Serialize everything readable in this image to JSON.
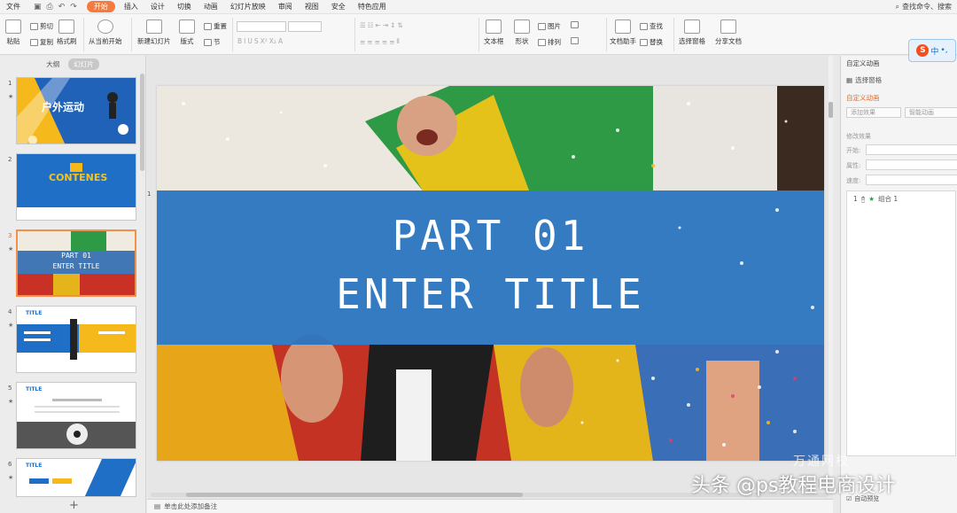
{
  "menu": {
    "file_label": "文件",
    "tabs": [
      "开始",
      "插入",
      "设计",
      "切换",
      "动画",
      "幻灯片放映",
      "审阅",
      "视图",
      "安全",
      "特色应用"
    ],
    "active_tab": "开始",
    "search_label": "查找命令、搜索"
  },
  "ribbon": {
    "paste": "粘贴",
    "cut": "剪切",
    "copy": "复制",
    "format_painter": "格式刷",
    "play_from_current": "从当前开始",
    "new_slide": "新建幻灯片",
    "layout": "版式",
    "reset": "重置",
    "section": "节",
    "textbox": "文本框",
    "shape": "形状",
    "picture": "图片",
    "arrange": "排列",
    "doc_assistant": "文档助手",
    "find": "查找",
    "replace": "替换",
    "select_pane": "选择窗格",
    "share_doc": "分享文档"
  },
  "left_panel": {
    "tab_outline": "大纲",
    "tab_slides": "幻灯片",
    "slides": [
      {
        "num": "1",
        "title": "户外运动"
      },
      {
        "num": "2",
        "title": "CONTENES"
      },
      {
        "num": "3",
        "title_line1": "PART 01",
        "title_line2": "ENTER TITLE"
      },
      {
        "num": "4",
        "title": "TITLE"
      },
      {
        "num": "5",
        "title": "TITLE"
      },
      {
        "num": "6",
        "title": "TITLE"
      }
    ],
    "add_icon": "+"
  },
  "slide": {
    "marker": "1",
    "title_line1": "PART 01",
    "title_line2": "ENTER TITLE"
  },
  "notes": {
    "placeholder": "单击此处添加备注"
  },
  "right_panel": {
    "title": "自定义动画",
    "select_pane": "选择窗格",
    "custom_anim": "自定义动画",
    "add_effect": "添加效果",
    "smart_anim": "智能动画",
    "modify_effect": "修改效果",
    "start_label": "开始:",
    "property_label": "属性:",
    "speed_label": "速度:",
    "anim_item_num": "1",
    "anim_item_name": "组合 1",
    "autopreview": "自动预览"
  },
  "ime": {
    "label": "中"
  },
  "watermark": {
    "text": "头条 @ps教程电商设计",
    "logo": "万通网校"
  },
  "colors": {
    "accent": "#f47b3d",
    "slide_band": "#1d6fc4",
    "selected_border": "#f1904a"
  }
}
